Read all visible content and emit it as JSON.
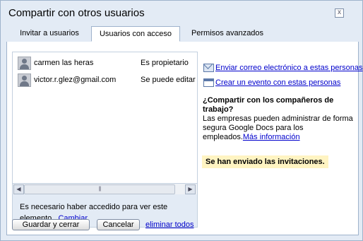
{
  "dialog": {
    "title": "Compartir con otros usuarios",
    "close_glyph": "x"
  },
  "tabs": [
    {
      "label": "Invitar a usuarios",
      "selected": false
    },
    {
      "label": "Usuarios con acceso",
      "selected": true
    },
    {
      "label": "Permisos avanzados",
      "selected": false
    }
  ],
  "users": [
    {
      "name": "carmen las heras",
      "access": "Es propietario"
    },
    {
      "name": "victor.r.glez@gmail.com",
      "access": "Se puede editar"
    }
  ],
  "scrollbar": {
    "left_glyph": "◀",
    "right_glyph": "▶",
    "thumb_glyph": "|||"
  },
  "access_note": {
    "line1": "Es necesario haber accedido para ver este",
    "line2": "elemento.",
    "link": "Cambiar"
  },
  "actions": {
    "email_link": "Enviar correo electrónico a estas personas",
    "event_link": "Crear un evento con estas personas"
  },
  "coworkers": {
    "title": "¿Compartir con los compañeros de trabajo?",
    "body": "Las empresas pueden administrar de forma segura Google Docs para los empleados.",
    "link": "Más información"
  },
  "invite_notice": "Se han enviado las invitaciones.",
  "buttons": {
    "save": "Guardar y cerrar",
    "cancel": "Cancelar",
    "delete_all": "eliminar todos"
  },
  "colors": {
    "dialog_bg": "#e3ebf5",
    "border": "#9fb3cc",
    "link": "#0000cc",
    "notice_bg": "#fff4c2"
  }
}
